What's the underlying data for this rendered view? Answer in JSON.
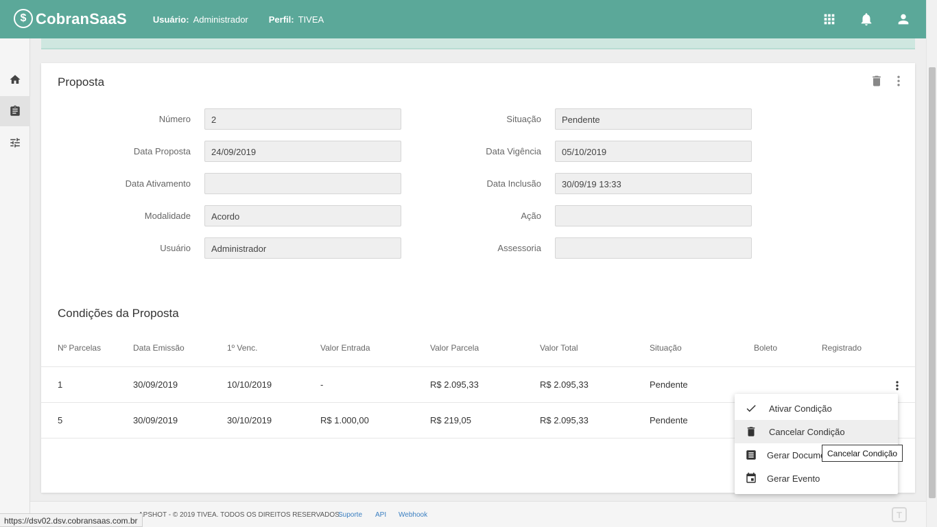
{
  "header": {
    "logo_symbol": "$",
    "logo_text": "CobranSaaS",
    "user_label": "Usuário:",
    "user_value": "Administrador",
    "profile_label": "Perfil:",
    "profile_value": "TIVEA",
    "icons": [
      "apps-grid-icon",
      "bell-icon",
      "account-icon"
    ],
    "background": "#5ba899"
  },
  "sidebar": {
    "items": [
      {
        "icon": "home-icon",
        "active": false
      },
      {
        "icon": "clipboard-icon",
        "active": true
      },
      {
        "icon": "sliders-icon",
        "active": false
      }
    ]
  },
  "proposal": {
    "title": "Proposta",
    "fields_left": [
      {
        "label": "Número",
        "value": "2"
      },
      {
        "label": "Data Proposta",
        "value": "24/09/2019"
      },
      {
        "label": "Data Ativamento",
        "value": ""
      },
      {
        "label": "Modalidade",
        "value": "Acordo"
      },
      {
        "label": "Usuário",
        "value": "Administrador"
      }
    ],
    "fields_right": [
      {
        "label": "Situação",
        "value": "Pendente"
      },
      {
        "label": "Data Vigência",
        "value": "05/10/2019"
      },
      {
        "label": "Data Inclusão",
        "value": "30/09/19 13:33"
      },
      {
        "label": "Ação",
        "value": ""
      },
      {
        "label": "Assessoria",
        "value": ""
      }
    ]
  },
  "conditions": {
    "title": "Condições da Proposta",
    "columns": [
      "Nº Parcelas",
      "Data Emissão",
      "1º Venc.",
      "Valor Entrada",
      "Valor Parcela",
      "Valor Total",
      "Situação",
      "Boleto",
      "Registrado"
    ],
    "rows": [
      [
        "1",
        "30/09/2019",
        "10/10/2019",
        "-",
        "R$ 2.095,33",
        "R$ 2.095,33",
        "Pendente",
        "",
        ""
      ],
      [
        "5",
        "30/09/2019",
        "30/10/2019",
        "R$ 1.000,00",
        "R$ 219,05",
        "R$ 2.095,33",
        "Pendente",
        "",
        ""
      ]
    ]
  },
  "menu": {
    "items": [
      {
        "label": "Ativar Condição",
        "icon": "check-icon"
      },
      {
        "label": "Cancelar Condição",
        "icon": "trash-icon"
      },
      {
        "label": "Gerar Docume",
        "icon": "document-icon"
      },
      {
        "label": "Gerar Evento",
        "icon": "calendar-event-icon"
      }
    ],
    "hovered_index": 1
  },
  "tooltip": "Cancelar Condição",
  "footer": {
    "copyright": "APSHOT - © 2019 TIVEA. TODOS OS DIREITOS RESERVADOS.",
    "links": [
      "Suporte",
      "API",
      "Webhook"
    ],
    "logo_glyph": "T"
  },
  "status_url": "https://dsv02.dsv.cobransaas.com.br"
}
